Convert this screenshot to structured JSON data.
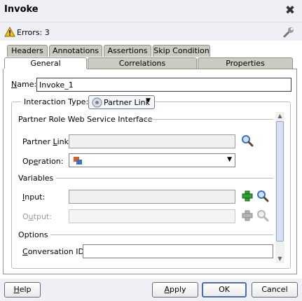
{
  "dialog": {
    "title": "Invoke"
  },
  "errors": {
    "text": "Errors: 3"
  },
  "tabs_row1": [
    {
      "label": "Headers"
    },
    {
      "label": "Annotations"
    },
    {
      "label": "Assertions"
    },
    {
      "label": "Skip Condition"
    }
  ],
  "tabs_row2": [
    {
      "label": "General",
      "active": true
    },
    {
      "label": "Correlations",
      "active": false
    },
    {
      "label": "Properties",
      "active": false
    }
  ],
  "general": {
    "name_label": "Name:",
    "name_value": "Invoke_1",
    "interaction_label": "Interaction Type:",
    "interaction_value": "Partner Link",
    "partner_section": "Partner Role Web Service Interface",
    "partner_link_label": "Partner Link:",
    "partner_link_value": "",
    "operation_label": "Operation:",
    "operation_value": "",
    "variables_section": "Variables",
    "input_label": "Input:",
    "input_value": "",
    "output_label": "Output:",
    "output_value": "",
    "options_section": "Options",
    "conversation_label": "Conversation ID:",
    "conversation_value": ""
  },
  "buttons": {
    "help": "Help",
    "apply": "Apply",
    "ok": "OK",
    "cancel": "Cancel"
  },
  "colors": {
    "warning": "#f5c400",
    "add_icon": "#2fa12f",
    "search_icon": "#3b6fc7",
    "default_button_border": "#4a6ea9"
  }
}
